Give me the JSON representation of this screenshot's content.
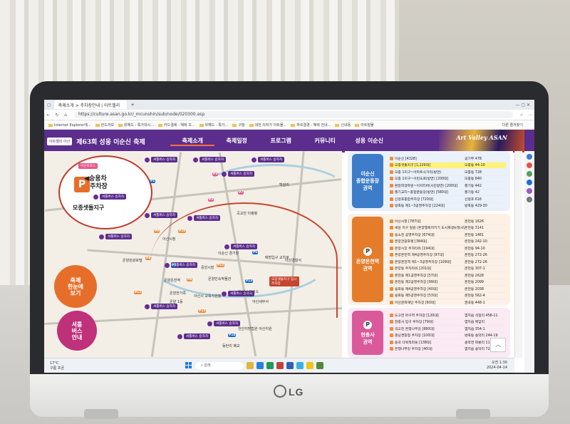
{
  "browser": {
    "tabs": [
      "축제소개 > 주차장안내 | 아트밸리",
      "+"
    ],
    "url": "https://culture.asan.go.kr/_mcunshin/sub/node/020300.asp",
    "favorites": [
      "Internet Explorer에...",
      "한드라보",
      "위해드 - 특가대시...",
      "카드결제 - 혜택 조...",
      "위해드 - 특가...",
      "구팡",
      "대전 의자가 아트물...",
      "하르결경 - 혜택 안내...",
      "신내용",
      "아트빌물"
    ],
    "favorites_right": "다른 즐겨찾기"
  },
  "site": {
    "badge": "아트밸리 아산",
    "festival_name": "제63회 성웅 이순신 축제",
    "nav": [
      "축제소개",
      "축제일정",
      "프로그램",
      "커뮤니티",
      "성웅 이순신"
    ],
    "art_title": "Art Valley ASAN"
  },
  "map": {
    "callout_top": "아산조모스",
    "callout_title_line1": "◀승용차",
    "callout_title_line2": "주차장",
    "callout_district": "모종샛들지구",
    "callout_parking": "P",
    "shuttle_labels": [
      "셔틀버스 승하차",
      "셔틀버스 승하차",
      "셔틀버스 승하차",
      "셔틀버스 승하차",
      "셔틀버스 승하차",
      "셔틀버스 승하차",
      "셔틀버스 승하차",
      "셔틀버스 승하차",
      "셔틀버스 승하차",
      "셔틀버스 승하차",
      "셔틀버스 승하차",
      "셔틀버스 승하차",
      "셔틀버스 승하차",
      "셔틀버스 승하차"
    ],
    "places": [
      "백암리",
      "곡교천 이랭평",
      "아산시청",
      "온양관광호텔",
      "온양온천역",
      "아산경찰서",
      "배방입구 교차로",
      "온양민속박물관",
      "이순신 경기장",
      "온양한가족",
      "아산시 보건소",
      "온양 1동",
      "아산시 교육지원청",
      "중앙시장",
      "아산세무서",
      "천안지방법원 아산지원",
      "동탄리 폐교"
    ],
    "p_markers": [
      "P1",
      "P2",
      "P3",
      "P4",
      "P5",
      "P6",
      "P7",
      "P8",
      "P9",
      "P10",
      "P11",
      "P12",
      "P13",
      "P14",
      "P15"
    ],
    "onyang_label": "모종샛들지구 임시주차장",
    "festival_btn": "축제\n한눈에\n보기",
    "shuttle_btn": "셔틀\n버스\n안내"
  },
  "panel": {
    "card1": {
      "title": "이순신\n종합운동장\n권역",
      "color": "#3d7cc9",
      "rows": [
        {
          "name": "이순신 [4328]",
          "count": "공기부 478",
          "hl": false
        },
        {
          "name": "모종샛들지구 [1,229대]",
          "count": "모종동 44-10",
          "hl": true
        },
        {
          "name": "모종 1지구~아파트사거리(방면)",
          "count": "모종동 728",
          "hl": false
        },
        {
          "name": "모종 1지구~이런도로(방면) [200대]",
          "count": "모종동 840",
          "hl": false
        },
        {
          "name": "환일학생학원~이지티버(사진방면) [200대]",
          "count": "풍기동 442",
          "hl": false
        },
        {
          "name": "풍기교차~종합운동장(방면) [580대]",
          "count": "풍기동 42",
          "hl": false
        },
        {
          "name": "신정호종합주차장 [720대]",
          "count": "신정호 616",
          "hl": false
        },
        {
          "name": "방축동 제1~3공영주차장 [224대]",
          "count": "방축동 429-30",
          "hl": false
        }
      ]
    },
    "card2": {
      "title": "온양온천역\n권역",
      "color": "#e57c2c",
      "rows": [
        {
          "name": "아산시청 [787대]",
          "count": "온천동 1626",
          "hl": false
        },
        {
          "name": "세원 지구 일원 (온양행복지키기 도시재생뉴딜사업) 온천동 공영주차장 [258대]",
          "count": "온천동 3141",
          "hl": false
        },
        {
          "name": "용소천 공영주차장 [674대]",
          "count": "온천동 1481",
          "hl": false
        },
        {
          "name": "온양관광호텔 [384대]",
          "count": "온천동 242-10",
          "hl": false
        },
        {
          "name": "온양시장 주차타워 [194대]",
          "count": "온천동 94-10",
          "hl": false
        },
        {
          "name": "온양온천역 제4공영주차장 [97대]",
          "count": "온천동 272-26",
          "hl": false
        },
        {
          "name": "온양온천역 제1~3공영주차장 [109대]",
          "count": "온천동 272-26",
          "hl": false
        },
        {
          "name": "온양동 주차타워 [201대]",
          "count": "온천동 307-1",
          "hl": false
        },
        {
          "name": "온천동 제1공영주차장 [57대]",
          "count": "온천동 2628",
          "hl": false
        },
        {
          "name": "온천동 제2공영주차장 [99대]",
          "count": "온천동 2099",
          "hl": false
        },
        {
          "name": "용화동 제4공영주차장 [40대]",
          "count": "온천동 2038",
          "hl": false
        },
        {
          "name": "용화동 제5공영주차장 [53대]",
          "count": "온천동 562-4",
          "hl": false
        },
        {
          "name": "아산문화재단 주차장 [60대]",
          "count": "권곡동 448-1",
          "hl": false
        }
      ]
    },
    "card3": {
      "title": "현충사\n권역",
      "color": "#d9599b",
      "rows": [
        {
          "name": "도고면 마구역 주차장 [120대]",
          "count": "염치읍 석정리 458-11",
          "hl": false
        },
        {
          "name": "현충사 입구 주차장 [79대]",
          "count": "염치읍 백암리",
          "hl": false
        },
        {
          "name": "곡교천 은행나무길 [880대]",
          "count": "염치읍 354-1",
          "hl": false
        },
        {
          "name": "충남경찰청 주차장 [100대]",
          "count": "방축동 송악리 244-19",
          "hl": false
        },
        {
          "name": "용곡 다목적마을 [138대]",
          "count": "송악면 회룡리 112-430",
          "hl": false
        },
        {
          "name": "은행나무길 주차장 [40대]",
          "count": "염치읍 송악리 72-12",
          "hl": false
        }
      ]
    }
  },
  "taskbar": {
    "weather_temp": "17°C",
    "weather_desc": "구름 조금",
    "search": "검색",
    "time": "오전 1:30",
    "date": "2024-04-14"
  },
  "laptop": {
    "brand": "LG"
  }
}
